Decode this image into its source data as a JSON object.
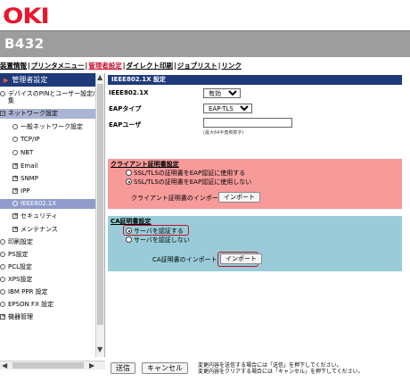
{
  "brand": {
    "logo_text": "OKI",
    "logo_color": "#e8172c"
  },
  "header": {
    "model": "B432"
  },
  "top_menu": {
    "items": [
      {
        "label": "装置情報",
        "active": false
      },
      {
        "label": "プリンタメニュー",
        "active": false
      },
      {
        "label": "管理者設定",
        "active": true
      },
      {
        "label": "ダイレクト印刷",
        "active": false
      },
      {
        "label": "ジョブリスト",
        "active": false
      },
      {
        "label": "リンク",
        "active": false
      }
    ],
    "separator": "|"
  },
  "sidebar": {
    "heading": "管理者設定",
    "items": [
      {
        "label": "デバイスのPINとユーザー設定/ホ",
        "icon": "circle"
      },
      {
        "label": "集",
        "icon": "none"
      },
      {
        "label": "ネットワーク設定",
        "icon": "minus-box"
      },
      {
        "label": "一般ネットワーク設定",
        "icon": "circle"
      },
      {
        "label": "TCP/IP",
        "icon": "circle"
      },
      {
        "label": "NBT",
        "icon": "circle"
      },
      {
        "label": "Email",
        "icon": "plus-box"
      },
      {
        "label": "SNMP",
        "icon": "plus-box"
      },
      {
        "label": "IPP",
        "icon": "plus-box"
      },
      {
        "label": "IEEE802.1X",
        "icon": "circle"
      },
      {
        "label": "セキュリティ",
        "icon": "plus-box"
      },
      {
        "label": "メンテナンス",
        "icon": "plus-box"
      },
      {
        "label": "印刷設定",
        "icon": "circle"
      },
      {
        "label": "PS設定",
        "icon": "circle"
      },
      {
        "label": "PCL設定",
        "icon": "circle"
      },
      {
        "label": "XPS設定",
        "icon": "circle"
      },
      {
        "label": "IBM PPR 設定",
        "icon": "circle"
      },
      {
        "label": "EPSON FX 設定",
        "icon": "circle"
      },
      {
        "label": "機器管理",
        "icon": "plus-box"
      }
    ]
  },
  "main": {
    "section_title": "IEEE802.1X 設定",
    "fields": {
      "ieee_label": "IEEE802.1X",
      "ieee_value": "有効",
      "eap_type_label": "EAPタイプ",
      "eap_type_value": "EAP-TLS",
      "eap_user_label": "EAPユーザ",
      "eap_user_value": "",
      "eap_user_hint": "(最大64半角英数字)"
    },
    "client_cert": {
      "title": "クライアント証明書設定",
      "option1": "SSL/TLSの証明書をEAP認証に使用する",
      "option2": "SSL/TLSの証明書をEAP認証に使用しない",
      "selected": 2,
      "import_label": "クライアント証明書のインポート",
      "import_button": "インポート"
    },
    "ca_cert": {
      "title": "CA証明書設定",
      "option1": "サーバを認証する",
      "option2": "サーバを認証しない",
      "selected": 1,
      "import_label": "CA証明書のインポート",
      "import_button": "インポート"
    }
  },
  "footer": {
    "send_button": "送信",
    "cancel_button": "キャンセル",
    "note_line1": "変更内容を送信する場合には「送信」を押下してください。",
    "note_line2": "変更内容をクリアする場合には「キャンセル」を押下してください。"
  },
  "colors": {
    "header_gray": "#9d9d9d",
    "nav_blue": "#1e3a7a",
    "pink_panel": "#f79a9a",
    "blue_panel": "#99ccd8",
    "highlight_red": "#c0102a"
  }
}
